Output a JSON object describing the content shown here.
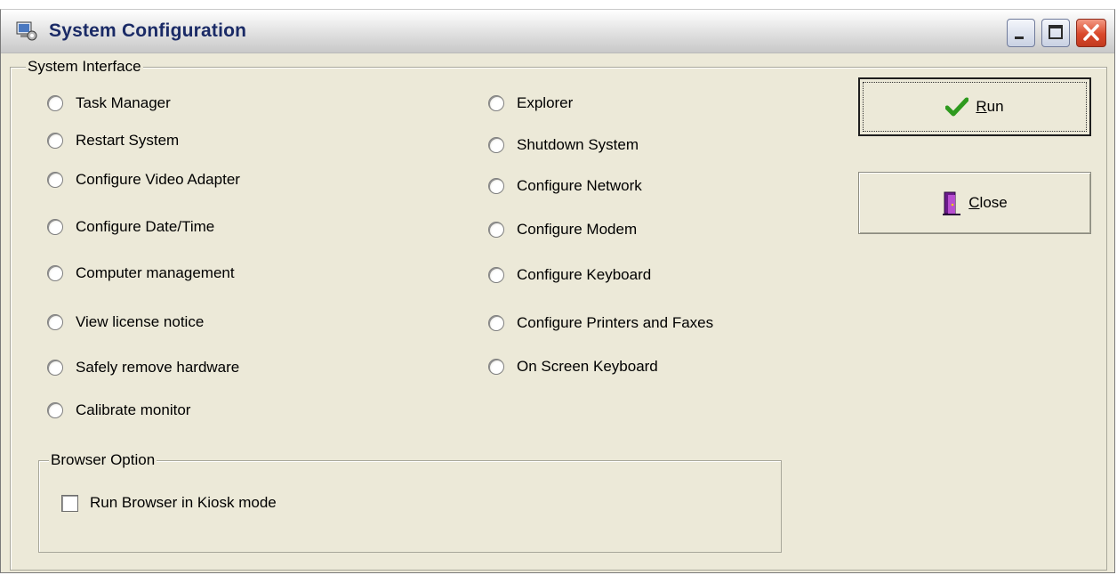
{
  "window": {
    "title": "System Configuration",
    "icons": {
      "app": "system-config-icon",
      "minimize": "minimize-icon",
      "maximize": "maximize-icon",
      "close": "close-icon"
    }
  },
  "system_interface": {
    "label": "System Interface",
    "left_options": [
      "Task Manager",
      "Restart System",
      "Configure Video Adapter",
      "Configure Date/Time",
      "Computer management",
      "View license notice",
      "Safely remove hardware",
      "Calibrate monitor"
    ],
    "right_options": [
      "Explorer",
      "Shutdown System",
      "Configure Network",
      "Configure Modem",
      "Configure Keyboard",
      "Configure Printers and Faxes",
      "On Screen Keyboard"
    ]
  },
  "browser_option": {
    "label": "Browser Option",
    "kiosk_label": "Run Browser in Kiosk mode",
    "kiosk_checked": false
  },
  "buttons": {
    "run": {
      "accel": "R",
      "rest": "un",
      "icon": "checkmark-icon",
      "color": "#2e9a1e"
    },
    "close": {
      "accel": "C",
      "rest": "lose",
      "icon": "door-exit-icon",
      "color": "#6a1a8a"
    }
  }
}
